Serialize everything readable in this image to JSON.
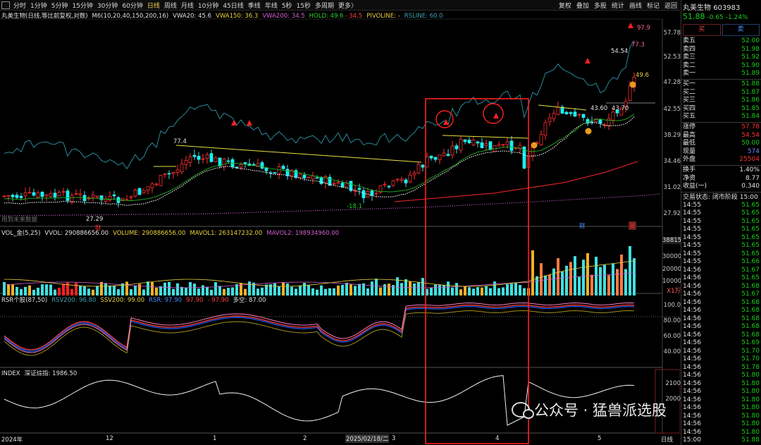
{
  "toolbar": {
    "tabs": [
      "分时",
      "1分钟",
      "5分钟",
      "15分钟",
      "30分钟",
      "60分钟",
      "日线",
      "周线",
      "月线",
      "10分钟",
      "45日线",
      "季线",
      "年线",
      "5秒",
      "15秒",
      "多周期",
      "更多〉"
    ],
    "active_tab": "日线",
    "right_buttons": [
      "复权",
      "叠加",
      "多股",
      "统计",
      "画线",
      "标记",
      "返回"
    ]
  },
  "main_legend": {
    "title": "丸美生物(日线,等比前复权,对数)",
    "m6": "M6(10,20,40,150,200,16)",
    "vwa20": "VWA20: 45.6",
    "vwa150": "VWA150: 36.3",
    "vwa200": "VWA200: 34.5",
    "hold": "HOLD: 49.6",
    "hold2": "- 34.5",
    "pivoline": "PIVOLINE: -",
    "rsline": "RSLINE: 60.0"
  },
  "price_axis": [
    "57.78",
    "52.53",
    "47.28",
    "42.55",
    "38.29",
    "34.46",
    "31.02",
    "27.92"
  ],
  "price_annotations": {
    "p77_4": "77.4",
    "p27_29": "27.29",
    "p18_1": "-18.1",
    "p97_9": "97.9",
    "p77_3": "77.3",
    "p54_54": "54.54",
    "p49_6": "49.6",
    "p43_60": "43.60",
    "p43_70": "43.70",
    "future_note": "用到未来数据",
    "cai_left": "财",
    "cai_right": "财",
    "zhang": "涨"
  },
  "vol_legend": {
    "name": "VOL_金(5,25)",
    "vvol": "VVOL: 290886656.00",
    "volume": "VOLUME: 290886656.00",
    "mavol1": "MAVOL1: 263147232.00",
    "mavol2": "MAVOL2: 198934960.00"
  },
  "vol_axis": [
    "38815",
    "30000",
    "20000",
    "10000",
    "X1万"
  ],
  "rsr_legend": {
    "name": "RSR个股(87,50)",
    "rsv200": "RSV200: 96.80",
    "ssv200": "SSV200: 99.00",
    "rsr": "RSR: 97.90",
    "v2": "97.90",
    "v3": "- 97.90",
    "duokong": "多空: 87.00"
  },
  "rsr_axis": [
    "100.0",
    "80.00",
    "60.00",
    "40.00"
  ],
  "index_legend": {
    "name": "INDEX",
    "label": "深证综指: 1986.50"
  },
  "index_axis": [
    "2100",
    "2000"
  ],
  "date_axis": {
    "d2024": "2024年",
    "d12": "12",
    "d1": "1",
    "d2": "2",
    "d20250218": "2025/02/18/二",
    "d3": "3",
    "d4": "4",
    "d5": "5",
    "period": "日线"
  },
  "watermark": "公众号 · 猛兽派选股",
  "panel": {
    "name": "丸美生物",
    "code": "603983",
    "price": "51.88",
    "change": "-0.65",
    "pct": "-1.24%",
    "buy_btn": "买",
    "sell_btn": "卖",
    "asks": [
      [
        "卖五",
        "52.00"
      ],
      [
        "卖四",
        "51.98"
      ],
      [
        "卖三",
        "51.92"
      ],
      [
        "卖二",
        "51.90"
      ],
      [
        "卖一",
        "51.89"
      ]
    ],
    "bids": [
      [
        "买一",
        "51.88"
      ],
      [
        "买二",
        "51.87"
      ],
      [
        "买三",
        "51.86"
      ],
      [
        "买四",
        "51.85"
      ],
      [
        "买五",
        "51.84"
      ]
    ],
    "quote": [
      {
        "k": "涨停",
        "v": "57.78",
        "c": "red"
      },
      {
        "k": "最高",
        "v": "54.54",
        "c": "red"
      },
      {
        "k": "最低",
        "v": "50.00",
        "c": "green"
      },
      {
        "k": "现量",
        "v": "574",
        "c": "blue"
      },
      {
        "k": "外盘",
        "v": "25504",
        "c": "red"
      }
    ],
    "stats": [
      {
        "k": "换手",
        "v": "1.40%"
      },
      {
        "k": "净资",
        "v": "8.77"
      },
      {
        "k": "收益(一)",
        "v": "0.340"
      }
    ],
    "status": "交易状态: 闭市阶段 15:00",
    "ticks": [
      [
        "14:55",
        "51.65"
      ],
      [
        "14:55",
        "51.65"
      ],
      [
        "14:55",
        "51.65"
      ],
      [
        "14:55",
        "51.65"
      ],
      [
        "14:55",
        "51.65"
      ],
      [
        "14:55",
        "51.65"
      ],
      [
        "14:55",
        "51.65"
      ],
      [
        "14:55",
        "51.66"
      ],
      [
        "14:56",
        "51.67"
      ],
      [
        "14:56",
        "51.65"
      ],
      [
        "14:56",
        "51.68"
      ],
      [
        "14:56",
        "51.67"
      ],
      [
        "14:56",
        "51.68"
      ],
      [
        "14:56",
        "51.68"
      ],
      [
        "14:56",
        "51.68"
      ],
      [
        "14:56",
        "51.68"
      ],
      [
        "14:56",
        "51.68"
      ],
      [
        "14:56",
        "51.69"
      ],
      [
        "14:56",
        "51.70"
      ],
      [
        "14:56",
        "51.70"
      ],
      [
        "14:56",
        "51.78"
      ],
      [
        "14:56",
        "51.80"
      ],
      [
        "14:56",
        "51.80"
      ],
      [
        "14:56",
        "51.80"
      ],
      [
        "14:56",
        "51.80"
      ],
      [
        "14:56",
        "51.80"
      ],
      [
        "14:56",
        "51.80"
      ],
      [
        "14:56",
        "51.80"
      ],
      [
        "14:56",
        "51.80"
      ],
      [
        "15:00",
        "51.88"
      ]
    ]
  },
  "colors": {
    "up": "#ff3030",
    "down": "#40e0e0",
    "down_fill": "#00ffff",
    "vwa20": "#e8e8e8",
    "vwa150": "#d060d0",
    "rs_line": "#2a8a9a",
    "hold": "#20b020",
    "trendline": "#e8e040",
    "ma200": "#c81e28"
  }
}
